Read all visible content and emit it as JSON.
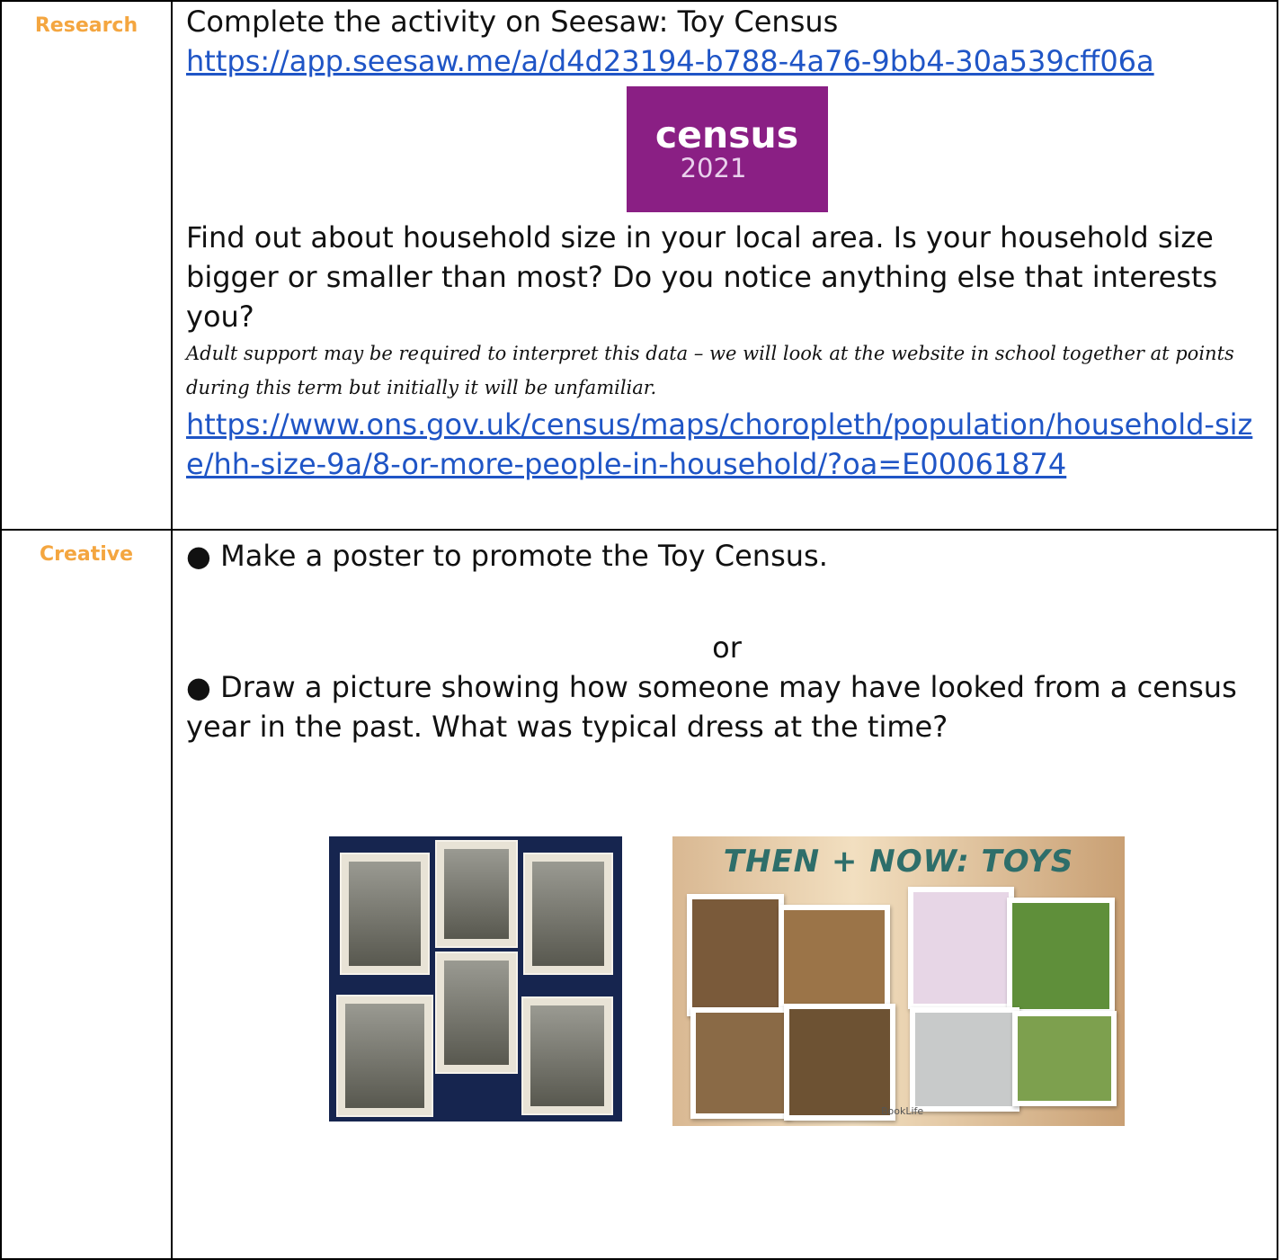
{
  "research": {
    "label": "Research",
    "intro": "Complete the activity on Seesaw: Toy Census",
    "seesaw_link": "https://app.seesaw.me/a/d4d23194-b788-4a76-9bb4-30a539cff06a",
    "logo": {
      "word": "census",
      "year": "2021",
      "color": "#8a1f84"
    },
    "question": "Find out about household size in your local area. Is your household size bigger or smaller than most?  Do you notice anything else that interests you?",
    "note": "Adult support may be required to interpret this data – we will look at the website in school together at points during this term but initially it will be unfamiliar.",
    "ons_link": "https://www.ons.gov.uk/census/maps/choropleth/population/household-size/hh-size-9a/8-or-more-people-in-household/?oa=E00061874"
  },
  "creative": {
    "label": "Creative",
    "option1": "● Make a poster to promote the Toy Census.",
    "or_text": "or",
    "option2": "● Draw a picture showing how someone may have looked from a census year in the past.  What was typical dress at the time?",
    "poster_title": "THEN + NOW: TOYS",
    "poster_brand": "BookLife"
  },
  "colors": {
    "label": "#f4a640",
    "link": "#1f55c6"
  }
}
